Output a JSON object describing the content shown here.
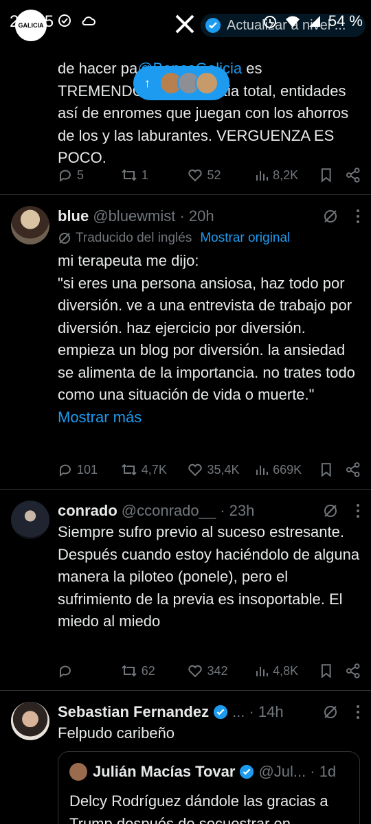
{
  "status_bar": {
    "time": "20:05",
    "battery": "54 %",
    "verify_prompt": "Actualizar a nivel ..."
  },
  "new_posts_pill": {
    "arrow": "↑"
  },
  "tweet1": {
    "text_line1": "de hacer pa",
    "mention": "@BancoGalicia",
    "text_line1_end": " es",
    "text_rest": "TREMENDO, una angustia total, entidades así de enromes que juegan con los ahorros de los y las laburantes. VERGUENZA ES POCO.",
    "replies": "5",
    "reposts": "1",
    "likes": "52",
    "views": "8,2K"
  },
  "tweet2": {
    "name": "blue",
    "handle": "@bluewmist · 20h",
    "translated_label": "Traducido del inglés",
    "show_original": "Mostrar original",
    "text": "mi terapeuta me dijo:\n\"si eres una persona ansiosa, haz todo por diversión. ve a una entrevista de trabajo por diversión. haz ejercicio por diversión. empieza un blog por diversión. la ansiedad se alimenta de la importancia. no trates todo como una situación de vida o muerte.\"",
    "show_more": "Mostrar más",
    "replies": "101",
    "reposts": "4,7K",
    "likes": "35,4K",
    "views": "669K"
  },
  "tweet3": {
    "name": "conrado",
    "handle": "@cconrado__ · 23h",
    "text": "Siempre sufro previo al suceso estresante. Después cuando estoy haciéndolo de alguna manera la piloteo (ponele), pero el sufrimiento de la previa es insoportable. El miedo al miedo",
    "replies": "",
    "reposts": "62",
    "likes": "342",
    "views": "4,8K"
  },
  "tweet4": {
    "name": "Sebastian Fernandez",
    "handle_trunc": "...",
    "time": "· 14h",
    "text": "Felpudo caribeño",
    "quote": {
      "name": "Julián Macías Tovar",
      "handle": "@Jul...",
      "time": "· 1d",
      "text": "Delcy Rodríguez dándole las gracias a Trump después de secuestrar en"
    }
  },
  "colors": {
    "accent": "#1d9bf0",
    "muted": "#71767b",
    "text": "#e7e9ea",
    "border": "#2f3336"
  }
}
